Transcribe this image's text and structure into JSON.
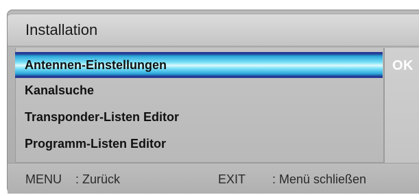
{
  "window": {
    "title": "Installation"
  },
  "menu": {
    "items": [
      {
        "label": "Antennen-Einstellungen",
        "selected": true
      },
      {
        "label": "Kanalsuche",
        "selected": false
      },
      {
        "label": "Transponder-Listen Editor",
        "selected": false
      },
      {
        "label": "Programm-Listen Editor",
        "selected": false
      }
    ]
  },
  "side": {
    "ok_label": "OK"
  },
  "footer": {
    "menu_key": "MENU",
    "menu_action": ": Zurück",
    "exit_key": "EXIT",
    "exit_action": ": Menü schließen"
  },
  "colors": {
    "highlight_core": "#dffafe",
    "highlight_edge": "#1f2f86",
    "panel_bg": "#c4c4c4"
  }
}
